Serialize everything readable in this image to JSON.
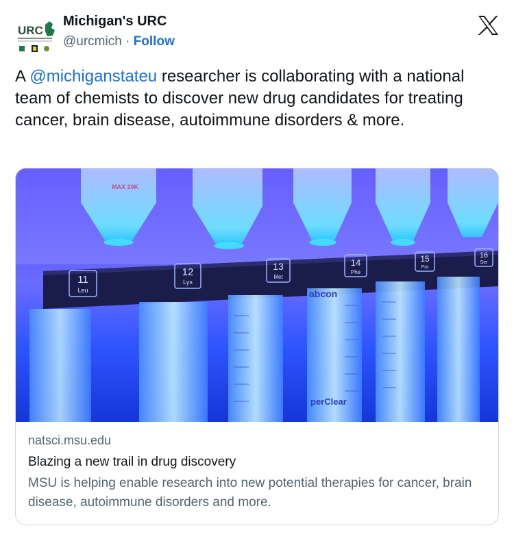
{
  "account": {
    "name": "Michigan's URC",
    "handle": "@urcmich",
    "separator": "·",
    "follow_label": "Follow",
    "avatar_text": "URC"
  },
  "tweet": {
    "prefix": "A ",
    "mention": "@michiganstateu",
    "rest": " researcher is collaborating with a national team of chemists to discover new drug candidates for treating cancer, brain disease, autoimmune disorders & more."
  },
  "card": {
    "domain": "natsci.msu.edu",
    "title": "Blazing a new trail in drug discovery",
    "description": "MSU is helping enable research into new potential therapies for cancer, brain disease, autoimmune disorders and more.",
    "image_labels": [
      {
        "num": "11",
        "abbr": "Leu"
      },
      {
        "num": "12",
        "abbr": "Lys"
      },
      {
        "num": "13",
        "abbr": "Met"
      },
      {
        "num": "14",
        "abbr": "Phe"
      },
      {
        "num": "15",
        "abbr": "Pro"
      },
      {
        "num": "16",
        "abbr": "Ser"
      }
    ],
    "image_brand_1": "abcon",
    "image_brand_2": "perClear",
    "image_tube_text": "MAX 20K"
  },
  "icons": {
    "logo": "x-logo-icon"
  },
  "colors": {
    "link": "#1d6fd1",
    "text": "#0f1419",
    "muted": "#536471",
    "border": "#cfd9de",
    "image_glow": "#1e3cff"
  }
}
